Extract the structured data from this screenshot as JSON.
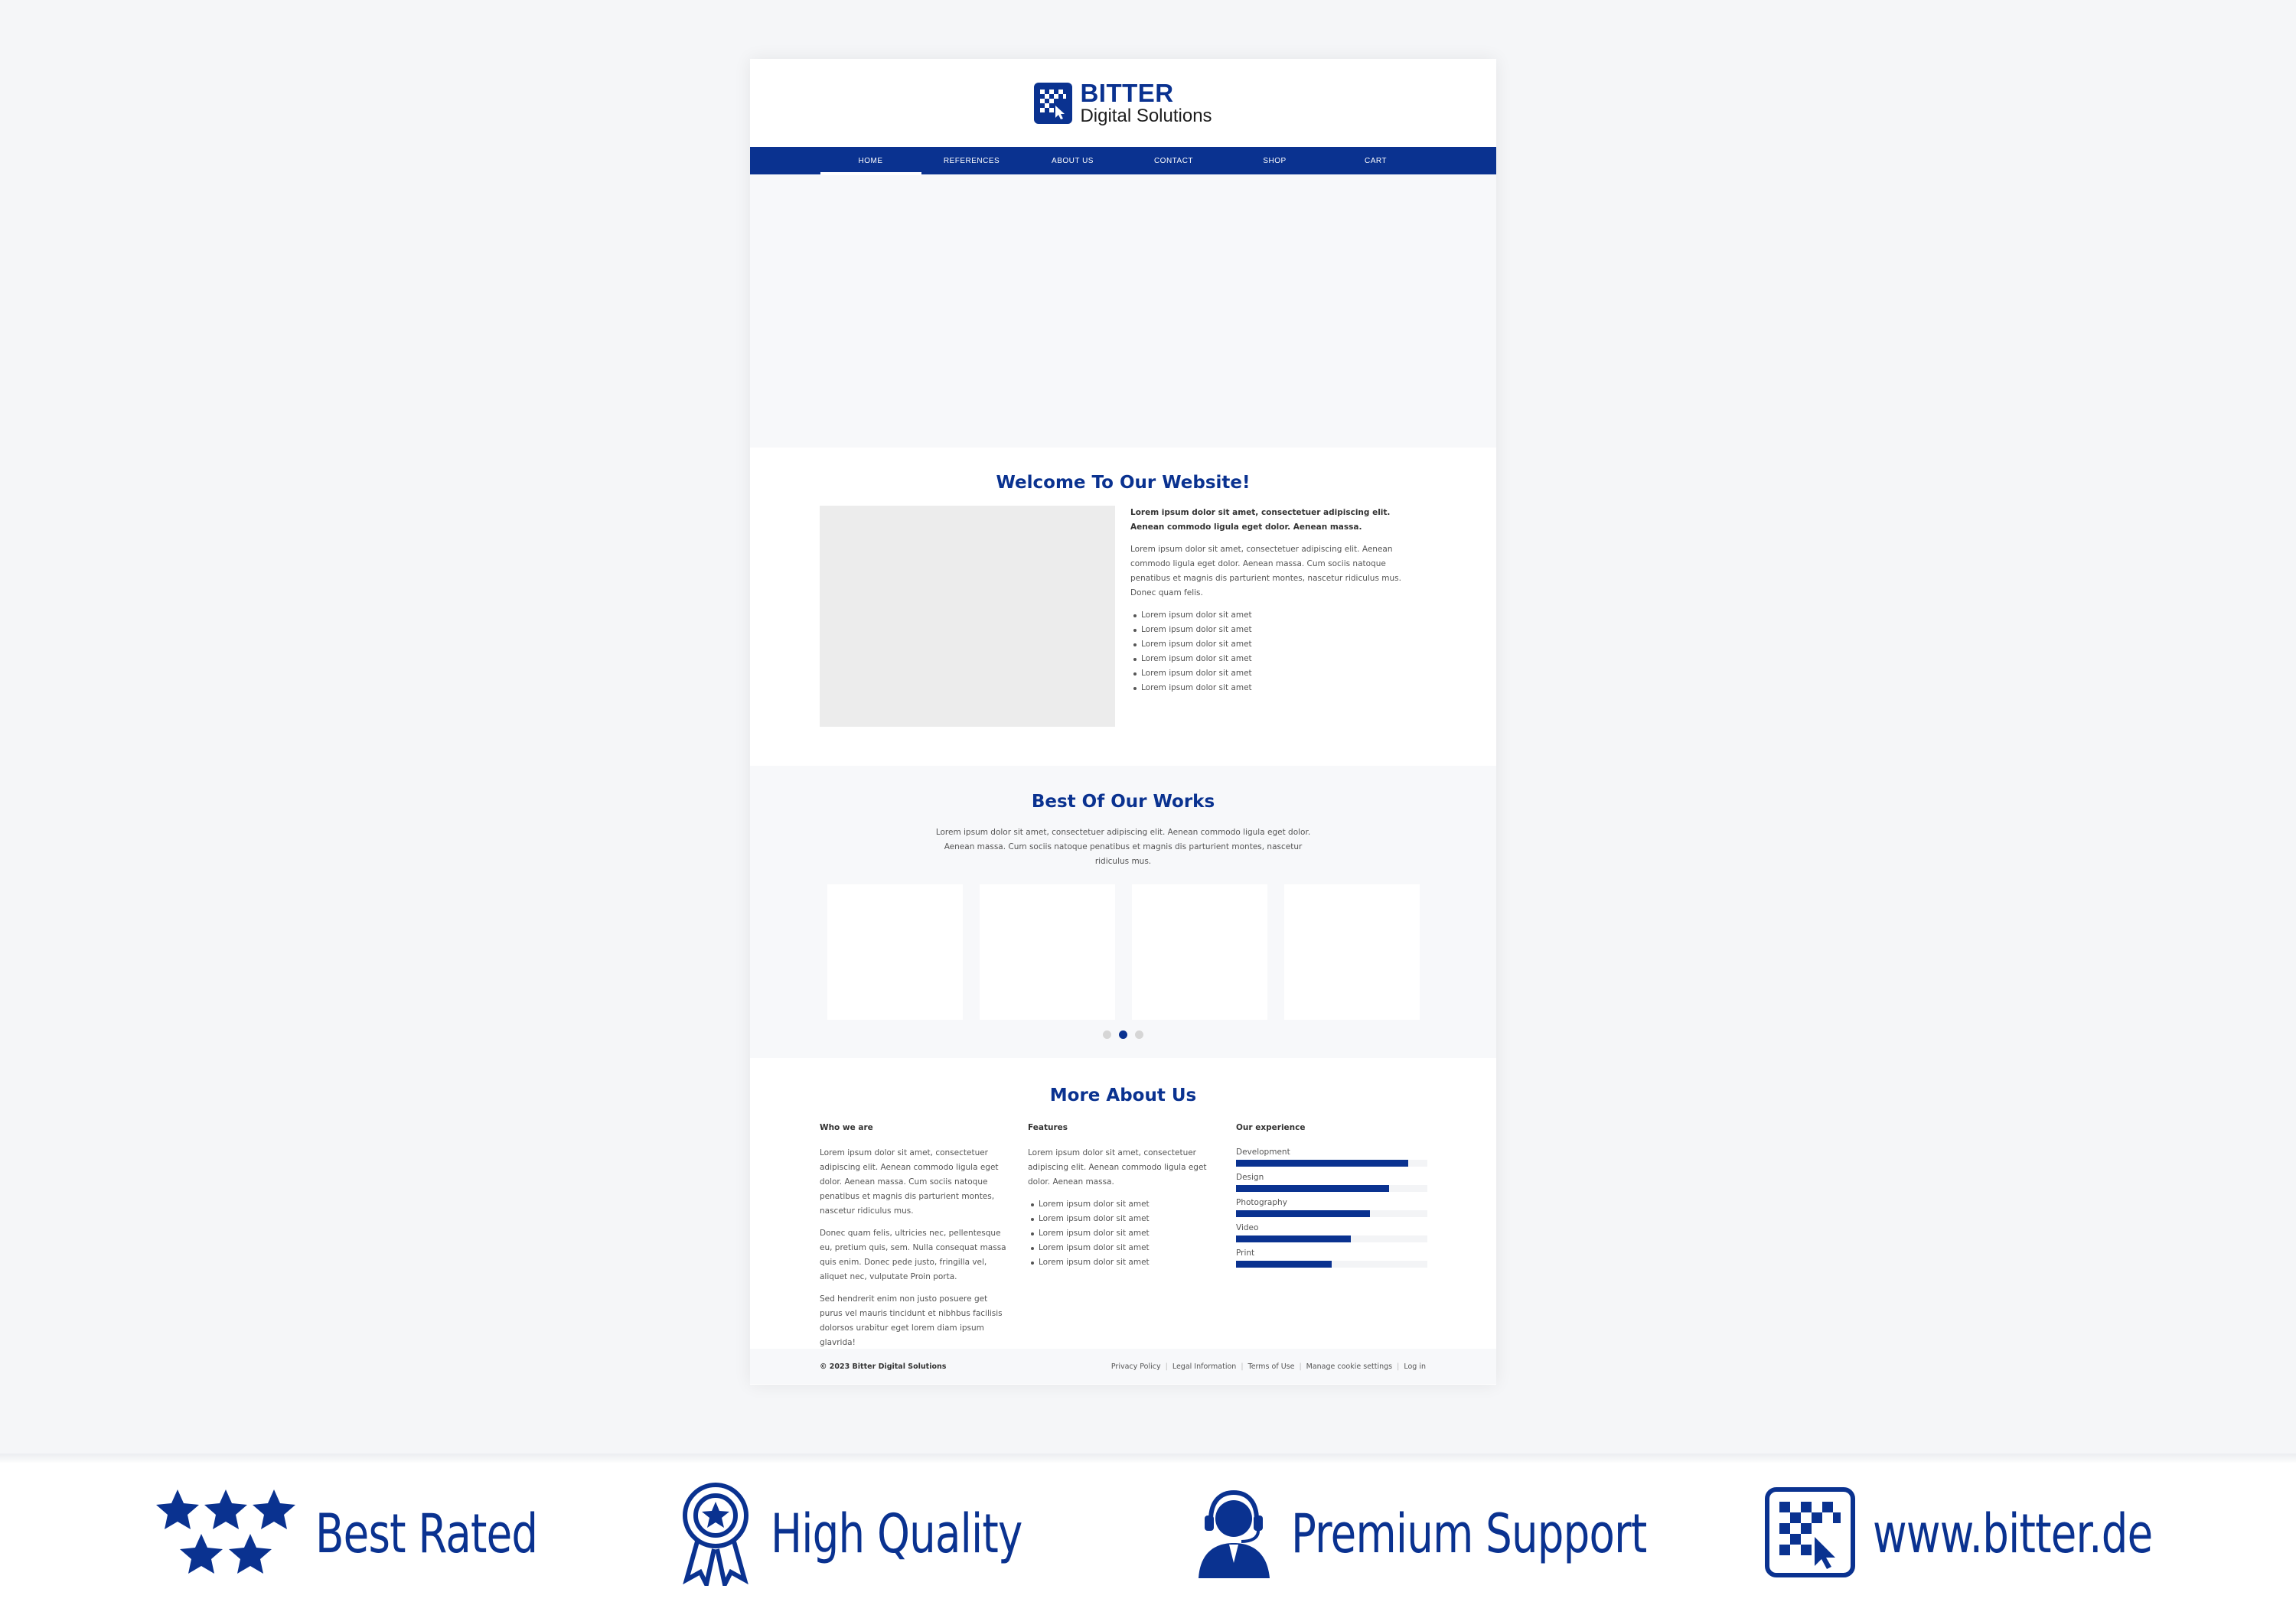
{
  "site": {
    "logo": {
      "line1": "BITTER",
      "line2": "Digital Solutions"
    },
    "nav": [
      "HOME",
      "REFERENCES",
      "ABOUT US",
      "CONTACT",
      "SHOP",
      "CART"
    ],
    "welcome": {
      "title": "Welcome To Our Website!",
      "lead": "Lorem ipsum dolor sit amet, consectetuer adipiscing elit. Aenean commodo ligula eget dolor. Aenean massa.",
      "body": "Lorem ipsum dolor sit amet, consectetuer adipiscing elit. Aenean commodo ligula eget dolor. Aenean massa. Cum sociis natoque penatibus et magnis dis parturient montes, nascetur ridiculus mus. Donec quam felis.",
      "bullets": [
        "Lorem ipsum dolor sit amet",
        "Lorem ipsum dolor sit amet",
        "Lorem ipsum dolor sit amet",
        "Lorem ipsum dolor sit amet",
        "Lorem ipsum dolor sit amet",
        "Lorem ipsum dolor sit amet"
      ]
    },
    "works": {
      "title": "Best Of Our Works",
      "subtitle": "Lorem ipsum dolor sit amet, consectetuer adipiscing elit. Aenean commodo ligula eget dolor. Aenean massa. Cum sociis natoque penatibus et magnis dis parturient montes, nascetur ridiculus mus."
    },
    "about": {
      "title": "More About Us",
      "who": {
        "heading": "Who we are",
        "p1": "Lorem ipsum dolor sit amet, consectetuer adipiscing elit. Aenean commodo ligula eget dolor. Aenean massa. Cum sociis natoque penatibus et magnis dis parturient montes, nascetur ridiculus mus.",
        "p2": "Donec quam felis, ultricies nec, pellentesque eu, pretium quis, sem. Nulla consequat massa quis enim. Donec pede justo, fringilla vel, aliquet nec, vulputate Proin porta.",
        "p3": "Sed hendrerit enim non justo posuere get purus vel mauris tincidunt et nibhbus facilisis dolorsos urabitur eget lorem diam ipsum glavrida!"
      },
      "features": {
        "heading": "Features",
        "p1": "Lorem ipsum dolor sit amet, consectetuer adipiscing elit. Aenean commodo ligula eget dolor. Aenean massa.",
        "bullets": [
          "Lorem ipsum dolor sit amet",
          "Lorem ipsum dolor sit amet",
          "Lorem ipsum dolor sit amet",
          "Lorem ipsum dolor sit amet",
          "Lorem ipsum dolor sit amet"
        ]
      },
      "experience": {
        "heading": "Our experience",
        "skills": [
          {
            "label": "Development",
            "level": 0.9
          },
          {
            "label": "Design",
            "level": 0.8
          },
          {
            "label": "Photography",
            "level": 0.7
          },
          {
            "label": "Video",
            "level": 0.6
          },
          {
            "label": "Print",
            "level": 0.5
          }
        ]
      }
    },
    "footer": {
      "copyright": "© 2023 Bitter Digital Solutions",
      "links": [
        "Privacy Policy",
        "Legal Information",
        "Terms of Use",
        "Manage cookie settings",
        "Log in"
      ]
    }
  },
  "banner": [
    {
      "icon": "stars-icon",
      "label": "Best Rated"
    },
    {
      "icon": "award-ribbon-icon",
      "label": "High Quality"
    },
    {
      "icon": "support-agent-icon",
      "label": "Premium Support"
    },
    {
      "icon": "bitter-logo-icon",
      "label": "www.bitter.de"
    }
  ],
  "colors": {
    "brand": "#0a3290",
    "background": "#f5f6f8",
    "section_alt": "#f7f8fa",
    "placeholder": "#ececec"
  }
}
